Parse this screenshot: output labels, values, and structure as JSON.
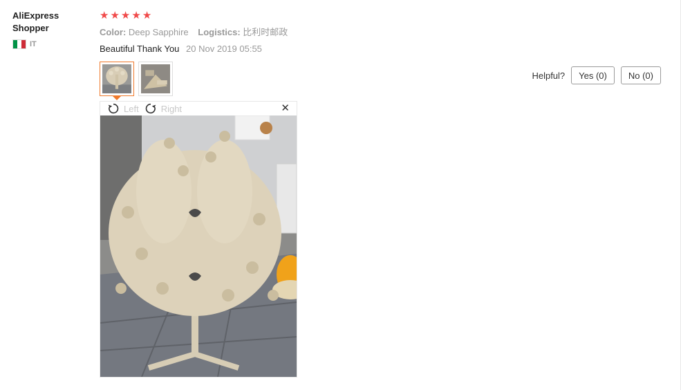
{
  "buyer": {
    "name": "AliExpress Shopper",
    "country_code": "IT"
  },
  "review": {
    "rating": 5,
    "stars": [
      "★",
      "★",
      "★",
      "★",
      "★"
    ],
    "star_color": "#f04a4a",
    "attributes": [
      {
        "label": "Color:",
        "value": "Deep Sapphire"
      },
      {
        "label": "Logistics:",
        "value": "比利时邮政"
      }
    ],
    "text": "Beautiful Thank You",
    "date": "20 Nov 2019 05:55"
  },
  "viewer": {
    "rotate_left_label": "Left",
    "rotate_right_label": "Right",
    "close_glyph": "✕"
  },
  "helpful": {
    "label": "Helpful?",
    "yes_label": "Yes (0)",
    "no_label": "No (0)"
  },
  "colors": {
    "accent_orange": "#f07a2c",
    "flag": [
      "#009246",
      "#ffffff",
      "#ce2b37"
    ]
  }
}
